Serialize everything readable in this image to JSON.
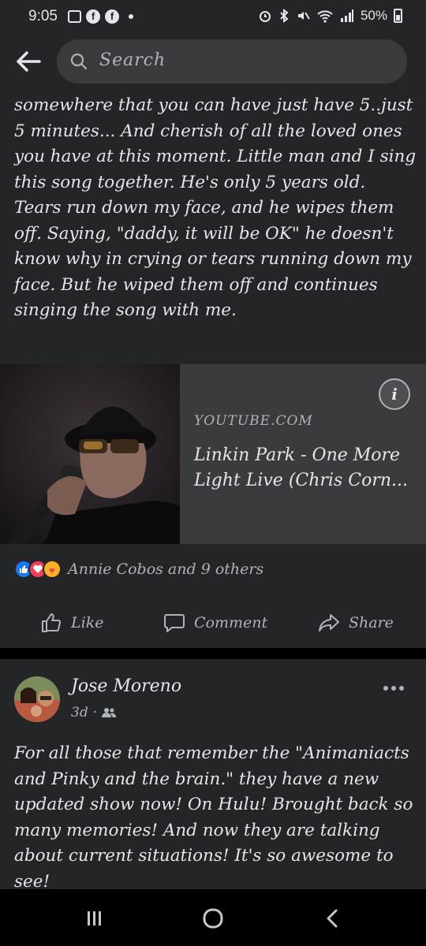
{
  "status_bar": {
    "time": "9:05",
    "battery": "50%",
    "icons": [
      "gallery-icon",
      "facebook-icon",
      "facebook-icon",
      "dot-icon",
      "alarm-icon",
      "bluetooth-icon",
      "mute-icon",
      "wifi-icon",
      "signal-icon",
      "battery-icon"
    ]
  },
  "header": {
    "search_placeholder": "Search"
  },
  "post1": {
    "text": "somewhere that you can have just have 5..just 5 minutes... And cherish of all the loved ones you have at this moment.  Little man and I sing this song together. He's only 5 years old. Tears run down my face, and he wipes them off. Saying, \"daddy, it will be OK\" he doesn't know why in crying or tears running down my face. But he wiped them off and continues singing the song with me.",
    "link": {
      "domain": "YOUTUBE.COM",
      "title": "Linkin Park - One More Light Live (Chris Corn...",
      "info_label": "i"
    },
    "reactions": {
      "icons": [
        "like-reaction-icon",
        "love-reaction-icon",
        "care-reaction-icon"
      ],
      "summary": "Annie Cobos and 9 others"
    },
    "actions": {
      "like": "Like",
      "comment": "Comment",
      "share": "Share"
    }
  },
  "post2": {
    "author": "Jose Moreno",
    "time": "3d",
    "separator": "·",
    "text": "For all those that remember the \"Animaniacts and Pinky and the brain.\" they have a new updated show now!  On Hulu!  Brought back so many memories! And now they are talking about current situations!  It's so awesome to see!"
  },
  "colors": {
    "background": "#000000",
    "surface": "#242526",
    "input": "#3a3b3c",
    "text_primary": "#e4e6eb",
    "text_secondary": "#b0b3b8",
    "like_blue": "#1877f2",
    "love_red": "#f33e58",
    "care_yellow": "#f7b125"
  }
}
